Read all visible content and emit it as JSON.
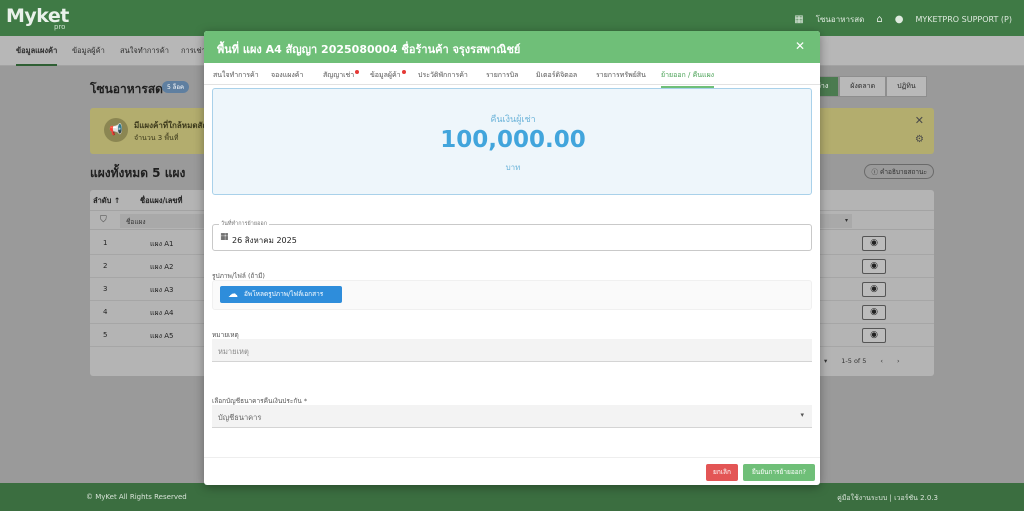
{
  "app": {
    "logo": "Myket",
    "logo_sub": "pro"
  },
  "topbar": {
    "store_icon": "store-icon",
    "store_label": "โซนอาหารสด",
    "home_icon": "home-icon",
    "user_icon": "person-icon",
    "user_label": "MYKETPRO SUPPORT (P)"
  },
  "subnav": {
    "tabs": [
      "ข้อมูลแผงค้า",
      "ข้อมูลผู้ค้า",
      "สนใจทำการค้า",
      "การเช่า"
    ]
  },
  "zone": {
    "title": "โซนอาหารสด",
    "badge": "5 ล็อค",
    "segments": [
      "ว่าง",
      "ผังตลาด",
      "ปฏิทิน"
    ],
    "active_segment": 0
  },
  "notice": {
    "icon": "megaphone-icon",
    "title": "มีแผงค้าที่ใกล้หมดสัญญา",
    "subtitle": "จำนวน 3 พื้นที่"
  },
  "list": {
    "title": "แผงทั้งหมด 5 แผง",
    "terms_button": "คำอธิบายสถานะ",
    "headers": {
      "order": "ลำดับ ↑",
      "name": "ชื่อแผง/เลขที่"
    },
    "filter_placeholder": "ชื่อแผง",
    "rows": [
      {
        "index": "1",
        "name": "แผง A1"
      },
      {
        "index": "2",
        "name": "แผง A2"
      },
      {
        "index": "3",
        "name": "แผง A3"
      },
      {
        "index": "4",
        "name": "แผง A4"
      },
      {
        "index": "5",
        "name": "แผง A5"
      }
    ],
    "pagination": "1-5 of 5"
  },
  "footer": {
    "left": "© MyKet All Rights Reserved",
    "right": "คู่มือใช้งานระบบ | เวอร์ชัน 2.0.3"
  },
  "modal": {
    "title": "พื้นที่ แผง A4 สัญญา 2025080004 ชื่อร้านค้า จรุงรสพาณิชย์",
    "close_icon": "close-icon",
    "tabs": [
      {
        "label": "สนใจทำการค้า",
        "dot": false
      },
      {
        "label": "จองแผงค้า",
        "dot": false
      },
      {
        "label": "สัญญาเช่า",
        "dot": true
      },
      {
        "label": "ข้อมูลผู้ค้า",
        "dot": true
      },
      {
        "label": "ประวัติพักการค้า",
        "dot": false
      },
      {
        "label": "รายการบิล",
        "dot": false
      },
      {
        "label": "มิเตอร์ดิจิตอล",
        "dot": false
      },
      {
        "label": "รายการทรัพย์สิน",
        "dot": false
      },
      {
        "label": "ย้ายออก / คืนแผง",
        "dot": false
      }
    ],
    "active_tab": 8,
    "refund": {
      "label": "คืนเงินผู้เช่า",
      "amount": "100,000.00",
      "unit": "บาท"
    },
    "date_field": {
      "label": "วันที่ทำการย้ายออก",
      "value": "26 สิงหาคม 2025",
      "icon": "calendar-icon"
    },
    "upload": {
      "label": "รูปภาพ/ไฟล์ (ถ้ามี)",
      "button": "อัพโหลดรูปภาพ/ไฟล์เอกสาร",
      "icon": "cloud-upload-icon"
    },
    "note": {
      "label": "หมายเหตุ",
      "placeholder": "หมายเหตุ"
    },
    "bank": {
      "label": "เลือกบัญชีธนาคารคืนเงินประกัน *",
      "placeholder": "บัญชีธนาคาร"
    },
    "buttons": {
      "cancel": "ยกเลิก",
      "confirm": "ยืนยันการย้ายออก?"
    }
  },
  "colors": {
    "header_green": "#6fbf78",
    "refund_blue": "#42a5dc",
    "upload_blue": "#2e8ddb",
    "cancel_red": "#e35555"
  }
}
